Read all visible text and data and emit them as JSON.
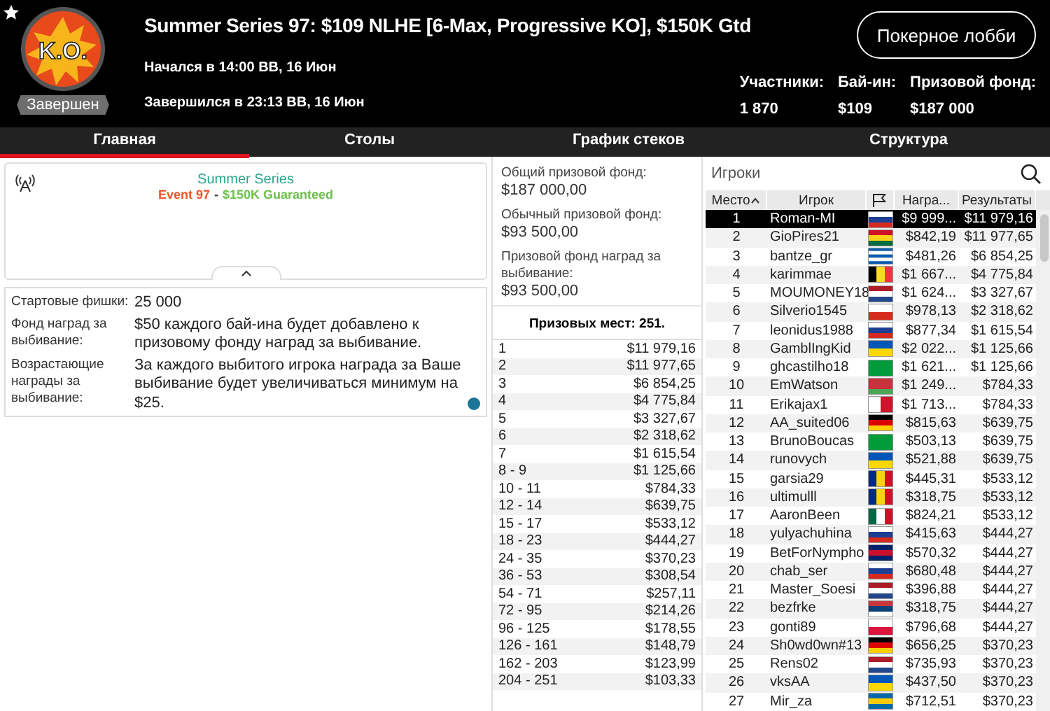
{
  "header": {
    "badge": "K.O.",
    "status": "Завершен",
    "title": "Summer Series 97: $109 NLHE [6-Max, Progressive KO], $150K Gtd",
    "started": "Начался в 14:00 ВВ, 16 Июн",
    "ended": "Завершился в 23:13 ВВ, 16 Июн",
    "lobby_button": "Покерное лобби",
    "stats": [
      {
        "label": "Участники:",
        "value": "1 870"
      },
      {
        "label": "Бай-ин:",
        "value": "$109"
      },
      {
        "label": "Призовой фонд:",
        "value": "$187 000"
      }
    ]
  },
  "tabs": [
    {
      "label": "Главная",
      "selected": true
    },
    {
      "label": "Столы",
      "selected": false
    },
    {
      "label": "График стеков",
      "selected": false
    },
    {
      "label": "Структура",
      "selected": false
    }
  ],
  "banner": {
    "title": "Summer Series",
    "event": "Event 97",
    "separator": "-",
    "guarantee": "$150K Guaranteed"
  },
  "info": [
    {
      "label": "Стартовые фишки:",
      "value": "25 000",
      "info_icon": false
    },
    {
      "label": "Фонд наград за выбивание:",
      "value": "$50 каждого бай-ина будет добавлено к призовому фонду наград за выбивание.",
      "info_icon": false
    },
    {
      "label": "Возрастающие награды за выбивание:",
      "value": "За каждого выбитого игрока награда за Ваше выбивание будет увеличиваться минимум на $25.",
      "info_icon": true
    }
  ],
  "pools": [
    {
      "label": "Общий призовой фонд:",
      "value": "$187 000,00"
    },
    {
      "label": "Обычный призовой фонд:",
      "value": "$93 500,00"
    },
    {
      "label": "Призовой фонд наград за выбивание:",
      "value": "$93 500,00"
    }
  ],
  "paid_places": "Призовых мест: 251.",
  "payouts": [
    {
      "place": "1",
      "prize": "$11 979,16"
    },
    {
      "place": "2",
      "prize": "$11 977,65"
    },
    {
      "place": "3",
      "prize": "$6 854,25"
    },
    {
      "place": "4",
      "prize": "$4 775,84"
    },
    {
      "place": "5",
      "prize": "$3 327,67"
    },
    {
      "place": "6",
      "prize": "$2 318,62"
    },
    {
      "place": "7",
      "prize": "$1 615,54"
    },
    {
      "place": "8 - 9",
      "prize": "$1 125,66"
    },
    {
      "place": "10 - 11",
      "prize": "$784,33"
    },
    {
      "place": "12 - 14",
      "prize": "$639,75"
    },
    {
      "place": "15 - 17",
      "prize": "$533,12"
    },
    {
      "place": "18 - 23",
      "prize": "$444,27"
    },
    {
      "place": "24 - 35",
      "prize": "$370,23"
    },
    {
      "place": "36 - 53",
      "prize": "$308,54"
    },
    {
      "place": "54 - 71",
      "prize": "$257,11"
    },
    {
      "place": "72 - 95",
      "prize": "$214,26"
    },
    {
      "place": "96 - 125",
      "prize": "$178,55"
    },
    {
      "place": "126 - 161",
      "prize": "$148,79"
    },
    {
      "place": "162 - 203",
      "prize": "$123,99"
    },
    {
      "place": "204 - 251",
      "prize": "$103,33"
    }
  ],
  "players": {
    "search_placeholder": "Игроки",
    "columns": [
      "Место",
      "Игрок",
      "Награ...",
      "Результаты"
    ],
    "rows": [
      {
        "place": "1",
        "name": "Roman-MI",
        "flag": {
          "kind": "h",
          "stripes": [
            {
              "color": "#ffffff"
            },
            {
              "color": "#1c3f94"
            },
            {
              "color": "#d52b1e"
            }
          ]
        },
        "bounty": "$9 999...",
        "result": "$11 979,16",
        "selected": true
      },
      {
        "place": "2",
        "name": "GioPires21",
        "flag": {
          "kind": "h",
          "stripes": [
            {
              "color": "#ce1126"
            },
            {
              "color": "#fcd116"
            },
            {
              "color": "#006b3f"
            }
          ]
        },
        "bounty": "$842,19",
        "result": "$11 977,65",
        "selected": false
      },
      {
        "place": "3",
        "name": "bantze_gr",
        "flag": {
          "kind": "h",
          "stripes": [
            {
              "color": "#0d5eaf"
            },
            {
              "color": "#ffffff"
            },
            {
              "color": "#0d5eaf"
            },
            {
              "color": "#ffffff"
            },
            {
              "color": "#0d5eaf"
            }
          ]
        },
        "bounty": "$481,26",
        "result": "$6 854,25",
        "selected": false
      },
      {
        "place": "4",
        "name": "karimmae",
        "flag": {
          "kind": "v",
          "stripes": [
            {
              "color": "#000000"
            },
            {
              "color": "#fdda24"
            },
            {
              "color": "#ef3340"
            }
          ]
        },
        "bounty": "$1 667...",
        "result": "$4 775,84",
        "selected": false
      },
      {
        "place": "5",
        "name": "MOUMONEY18",
        "flag": {
          "kind": "h",
          "stripes": [
            {
              "color": "#ae1c28"
            },
            {
              "color": "#ffffff"
            },
            {
              "color": "#21468b"
            }
          ]
        },
        "bounty": "$1 624...",
        "result": "$3 327,67",
        "selected": false
      },
      {
        "place": "6",
        "name": "Silverio1545",
        "flag": {
          "kind": "h",
          "stripes": [
            {
              "color": "#ffffff"
            },
            {
              "color": "#d52b1e"
            }
          ]
        },
        "bounty": "$978,13",
        "result": "$2 318,62",
        "selected": false
      },
      {
        "place": "7",
        "name": "leonidus1988",
        "flag": {
          "kind": "h",
          "stripes": [
            {
              "color": "#ffffff"
            },
            {
              "color": "#1c3f94"
            },
            {
              "color": "#d52b1e"
            }
          ]
        },
        "bounty": "$877,34",
        "result": "$1 615,54",
        "selected": false
      },
      {
        "place": "8",
        "name": "GamblIngKid",
        "flag": {
          "kind": "h",
          "stripes": [
            {
              "color": "#0057b7"
            },
            {
              "color": "#ffd700"
            }
          ]
        },
        "bounty": "$2 022...",
        "result": "$1 125,66",
        "selected": false
      },
      {
        "place": "9",
        "name": "ghcastilho18",
        "flag": {
          "kind": "h",
          "stripes": [
            {
              "color": "#009c3b"
            }
          ]
        },
        "bounty": "$1 621...",
        "result": "$1 125,66",
        "selected": false
      },
      {
        "place": "10",
        "name": "EmWatson",
        "flag": {
          "kind": "h",
          "stripes": [
            {
              "color": "#c8313e"
            },
            {
              "color": "#c8313e"
            },
            {
              "color": "#4aa657"
            }
          ]
        },
        "bounty": "$1 249...",
        "result": "$784,33",
        "selected": false
      },
      {
        "place": "11",
        "name": "Erikajax1",
        "flag": {
          "kind": "v",
          "stripes": [
            {
              "color": "#ffffff"
            },
            {
              "color": "#cf142b"
            }
          ]
        },
        "bounty": "$1 713...",
        "result": "$784,33",
        "selected": false
      },
      {
        "place": "12",
        "name": "AA_suited06",
        "flag": {
          "kind": "h",
          "stripes": [
            {
              "color": "#000000"
            },
            {
              "color": "#dd0000"
            },
            {
              "color": "#ffce00"
            }
          ]
        },
        "bounty": "$815,63",
        "result": "$639,75",
        "selected": false
      },
      {
        "place": "13",
        "name": "BrunoBoucas",
        "flag": {
          "kind": "h",
          "stripes": [
            {
              "color": "#009c3b"
            }
          ]
        },
        "bounty": "$503,13",
        "result": "$639,75",
        "selected": false
      },
      {
        "place": "14",
        "name": "runovych",
        "flag": {
          "kind": "h",
          "stripes": [
            {
              "color": "#0057b7"
            },
            {
              "color": "#ffd700"
            }
          ]
        },
        "bounty": "$521,88",
        "result": "$639,75",
        "selected": false
      },
      {
        "place": "15",
        "name": "garsia29",
        "flag": {
          "kind": "v",
          "stripes": [
            {
              "color": "#002b7f"
            },
            {
              "color": "#fcd116"
            },
            {
              "color": "#ce1126"
            }
          ]
        },
        "bounty": "$445,31",
        "result": "$533,12",
        "selected": false
      },
      {
        "place": "16",
        "name": "ultimulll",
        "flag": {
          "kind": "v",
          "stripes": [
            {
              "color": "#002b7f"
            },
            {
              "color": "#fcd116"
            },
            {
              "color": "#ce1126"
            }
          ]
        },
        "bounty": "$318,75",
        "result": "$533,12",
        "selected": false
      },
      {
        "place": "17",
        "name": "AaronBeen",
        "flag": {
          "kind": "v",
          "stripes": [
            {
              "color": "#006847"
            },
            {
              "color": "#ffffff"
            },
            {
              "color": "#ce1126"
            }
          ]
        },
        "bounty": "$824,21",
        "result": "$533,12",
        "selected": false
      },
      {
        "place": "18",
        "name": "yulyachuhina",
        "flag": {
          "kind": "h",
          "stripes": [
            {
              "color": "#ffffff"
            },
            {
              "color": "#1c3f94"
            },
            {
              "color": "#d52b1e"
            }
          ]
        },
        "bounty": "$415,63",
        "result": "$444,27",
        "selected": false
      },
      {
        "place": "19",
        "name": "BetForNympho",
        "flag": {
          "kind": "h",
          "stripes": [
            {
              "color": "#012169"
            },
            {
              "color": "#c8102e"
            },
            {
              "color": "#012169"
            }
          ]
        },
        "bounty": "$570,32",
        "result": "$444,27",
        "selected": false
      },
      {
        "place": "20",
        "name": "chab_ser",
        "flag": {
          "kind": "h",
          "stripes": [
            {
              "color": "#ffffff"
            },
            {
              "color": "#1c3f94"
            },
            {
              "color": "#d52b1e"
            }
          ]
        },
        "bounty": "$680,48",
        "result": "$444,27",
        "selected": false
      },
      {
        "place": "21",
        "name": "Master_Soesi",
        "flag": {
          "kind": "h",
          "stripes": [
            {
              "color": "#ae1c28"
            },
            {
              "color": "#ffffff"
            },
            {
              "color": "#21468b"
            }
          ]
        },
        "bounty": "$396,88",
        "result": "$444,27",
        "selected": false
      },
      {
        "place": "22",
        "name": "bezfrke",
        "flag": {
          "kind": "h",
          "stripes": [
            {
              "color": "#c6363c"
            },
            {
              "color": "#0c4076"
            },
            {
              "color": "#ffffff"
            }
          ]
        },
        "bounty": "$318,75",
        "result": "$444,27",
        "selected": false
      },
      {
        "place": "23",
        "name": "gonti89",
        "flag": {
          "kind": "h",
          "stripes": [
            {
              "color": "#ffffff"
            },
            {
              "color": "#dc143c"
            }
          ]
        },
        "bounty": "$796,68",
        "result": "$444,27",
        "selected": false
      },
      {
        "place": "24",
        "name": "Sh0wd0wn#13",
        "flag": {
          "kind": "h",
          "stripes": [
            {
              "color": "#000000"
            },
            {
              "color": "#dd0000"
            },
            {
              "color": "#ffce00"
            }
          ]
        },
        "bounty": "$656,25",
        "result": "$370,23",
        "selected": false
      },
      {
        "place": "25",
        "name": "Rens02",
        "flag": {
          "kind": "h",
          "stripes": [
            {
              "color": "#ae1c28"
            },
            {
              "color": "#ffffff"
            },
            {
              "color": "#21468b"
            }
          ]
        },
        "bounty": "$735,93",
        "result": "$370,23",
        "selected": false
      },
      {
        "place": "26",
        "name": "vksAA",
        "flag": {
          "kind": "h",
          "stripes": [
            {
              "color": "#0057b7"
            },
            {
              "color": "#ffd700"
            }
          ]
        },
        "bounty": "$437,50",
        "result": "$370,23",
        "selected": false
      },
      {
        "place": "27",
        "name": "Mir_za",
        "flag": {
          "kind": "h",
          "stripes": [
            {
              "color": "#006aa7"
            },
            {
              "color": "#fecc00"
            },
            {
              "color": "#006aa7"
            }
          ]
        },
        "bounty": "$712,51",
        "result": "$370,23",
        "selected": false
      }
    ]
  }
}
